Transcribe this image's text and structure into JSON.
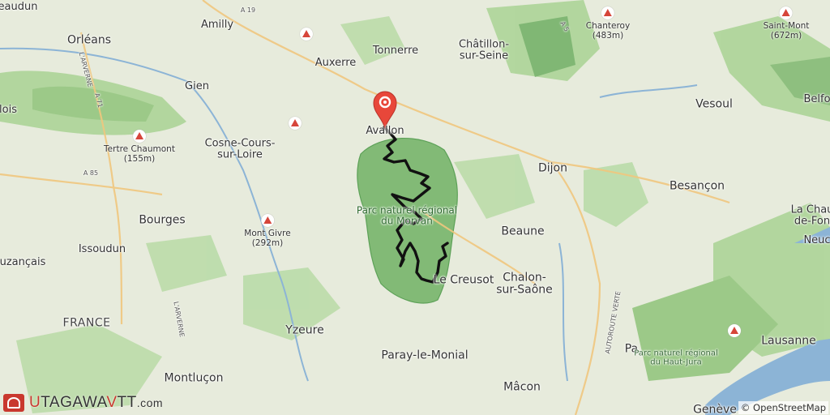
{
  "map": {
    "colors": {
      "forest": "#9ccc8a",
      "forest_dark": "#6aa85e",
      "park": "#7bb66f",
      "water": "#8cb4d6",
      "route": "#111111",
      "pin": "#e8473a",
      "logo_red": "#c9382e"
    },
    "cities": [
      {
        "id": "orleans",
        "label": "Orléans"
      },
      {
        "id": "amilly",
        "label": "Amilly"
      },
      {
        "id": "auxerre",
        "label": "Auxerre"
      },
      {
        "id": "tonnerre",
        "label": "Tonnerre"
      },
      {
        "id": "chatillon",
        "label": "Châtillon-\nsur-Seine"
      },
      {
        "id": "gien",
        "label": "Gien"
      },
      {
        "id": "blois",
        "label": "lois"
      },
      {
        "id": "beaudun",
        "label": "eaudun"
      },
      {
        "id": "cosne",
        "label": "Cosne-Cours-\nsur-Loire"
      },
      {
        "id": "avallon",
        "label": "Avallon"
      },
      {
        "id": "vesoul",
        "label": "Vesoul"
      },
      {
        "id": "belfort",
        "label": "Belfo"
      },
      {
        "id": "dijon",
        "label": "Dijon"
      },
      {
        "id": "besancon",
        "label": "Besançon"
      },
      {
        "id": "bourges",
        "label": "Bourges"
      },
      {
        "id": "issoudun",
        "label": "Issoudun"
      },
      {
        "id": "vierzon",
        "label": "uzançais"
      },
      {
        "id": "beaune",
        "label": "Beaune"
      },
      {
        "id": "chaux",
        "label": "La Chau\nde-Fon"
      },
      {
        "id": "neuch",
        "label": "Neuc"
      },
      {
        "id": "creusot",
        "label": "Le Creusot"
      },
      {
        "id": "chalon",
        "label": "Chalon-\nsur-Saône"
      },
      {
        "id": "yzeure",
        "label": "Yzeure"
      },
      {
        "id": "paray",
        "label": "Paray-le-Monial"
      },
      {
        "id": "lausanne",
        "label": "Lausanne"
      },
      {
        "id": "montlucon",
        "label": "Montluçon"
      },
      {
        "id": "macon",
        "label": "Mâcon"
      },
      {
        "id": "geneve",
        "label": "Genève"
      },
      {
        "id": "pa",
        "label": "Pa"
      }
    ],
    "country": "FRANCE",
    "parks": [
      {
        "id": "morvan",
        "label": "Parc naturel régional\ndu Morvan"
      },
      {
        "id": "jura",
        "label": "Parc naturel régional\ndu Haut-Jura"
      }
    ],
    "peaks": [
      {
        "id": "chanteroy",
        "label": "Chanteroy\n(483m)"
      },
      {
        "id": "saintmont",
        "label": "Saint-Mont\n(672m)"
      },
      {
        "id": "tertre",
        "label": "Tertre Chaumont\n(155m)"
      },
      {
        "id": "givre",
        "label": "Mont Givre\n(292m)"
      }
    ],
    "roads": [
      {
        "id": "a19",
        "label": "A 19"
      },
      {
        "id": "a5",
        "label": "A 5"
      },
      {
        "id": "a71",
        "label": "A 71"
      },
      {
        "id": "a85",
        "label": "A 85"
      },
      {
        "id": "arverne1",
        "label": "L'ARVERNE"
      },
      {
        "id": "arverne2",
        "label": "L'ARVERNE"
      },
      {
        "id": "verte",
        "label": "AUTOROUTE VERTE"
      }
    ],
    "attribution": "© OpenStreetMap",
    "logo": {
      "u": "U",
      "tagawa": "TAGAWA",
      "v": "V",
      "tt": "TT",
      "dom": ".com"
    },
    "icons": {
      "pin": "location-pin-icon",
      "peak": "peak-triangle-icon",
      "logo": "utagawa-logo-icon"
    }
  }
}
